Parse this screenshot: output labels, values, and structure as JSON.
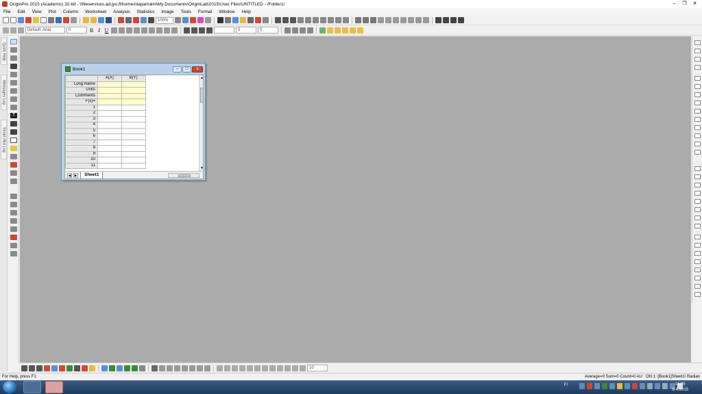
{
  "window": {
    "title": "OriginPro 2015 (Academic) 32-bit - \\\\fileservices.ad.jyu.fi\\homes\\tapamalm\\My Documents\\OriginLab\\2015\\User Files\\UNTITLED - /Folder1/"
  },
  "menu": {
    "items": [
      "File",
      "Edit",
      "View",
      "Plot",
      "Column",
      "Worksheet",
      "Analysis",
      "Statistics",
      "Image",
      "Tools",
      "Format",
      "Window",
      "Help"
    ]
  },
  "toolbar1": {
    "zoom": "100%"
  },
  "toolbar2": {
    "font_name": "Default: Arial",
    "font_size": "0",
    "line_width": "0",
    "line_width2": "0"
  },
  "left_dock": {
    "tabs": [
      "Quick Help",
      "Messages Log",
      "Smart Hint Log"
    ]
  },
  "bottom_toolbar": {
    "size": "10"
  },
  "status": {
    "help": "For Help, press F1",
    "summary": "Average=0 Sum=0 Count=0   AU : ON      1: [Book1]Sheet1!   Radian"
  },
  "taskbar": {
    "tray_label": "FI",
    "clock_time": "11:35",
    "clock_date": "8.4.2015"
  },
  "workbook": {
    "title": "Book1",
    "min_label": "–",
    "max_label": "□",
    "close_label": "x",
    "columns": [
      "A(X)",
      "B(Y)"
    ],
    "label_rows": [
      "Long Name",
      "Units",
      "Comments",
      "F(x)="
    ],
    "rows": [
      "1",
      "2",
      "3",
      "4",
      "5",
      "6",
      "7",
      "8",
      "9",
      "10",
      "11"
    ],
    "tab": "Sheet1",
    "nav_prev": "◀",
    "nav_next": "▶"
  },
  "colors": {
    "workspace": "#ababab",
    "label_row_bg": "#ffffcc",
    "window_frame": "#b9d1ea",
    "close_button": "#c9483b"
  }
}
